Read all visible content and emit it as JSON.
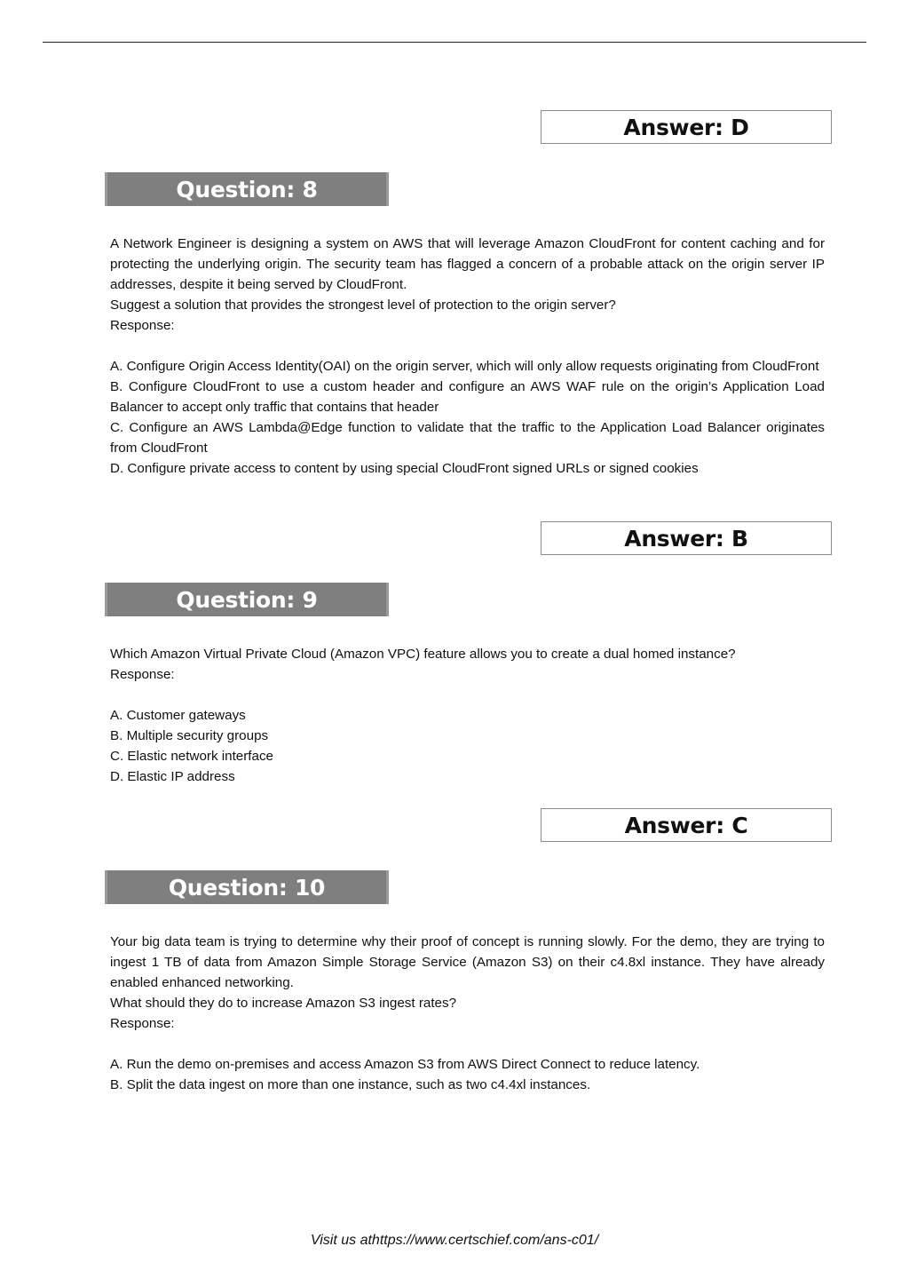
{
  "page": {
    "answers": [
      {
        "label": "Answer: D"
      },
      {
        "label": "Answer: B"
      },
      {
        "label": "Answer: C"
      }
    ],
    "questions": [
      {
        "title": "Question: 8",
        "stem": "A Network Engineer is designing a system on AWS that will leverage Amazon CloudFront for content caching and for protecting the underlying origin. The security team has flagged a concern of a probable attack on the origin server IP addresses, despite it being served by CloudFront.",
        "prompt": "Suggest a solution that provides the strongest level of protection to the origin server?",
        "response_label": "Response:",
        "options": [
          "A. Configure Origin Access Identity(OAI) on the origin server, which will only allow requests originating from CloudFront",
          "B. Configure CloudFront to use a custom header and configure an AWS WAF rule on the origin’s Application Load Balancer to accept only traffic that contains that header",
          "C. Configure an AWS Lambda@Edge function to validate that the traffic to the Application Load Balancer originates from CloudFront",
          "D. Configure private access to content by using special CloudFront signed URLs or signed cookies"
        ]
      },
      {
        "title": "Question: 9",
        "stem": "Which Amazon Virtual Private Cloud (Amazon VPC) feature allows you to create a dual homed instance?",
        "response_label": "Response:",
        "options": [
          "A. Customer gateways",
          "B. Multiple security groups",
          "C. Elastic network interface",
          "D. Elastic IP address"
        ]
      },
      {
        "title": "Question: 10",
        "stem": "Your big data team is trying to determine why their proof of concept is running slowly. For the demo, they are trying to ingest 1 TB of data from Amazon Simple Storage Service (Amazon S3) on their c4.8xl instance. They have already enabled enhanced networking.",
        "prompt": "What should they do to increase Amazon S3 ingest rates?",
        "response_label": "Response:",
        "options": [
          "A. Run the demo on-premises and access Amazon S3 from AWS Direct Connect to reduce latency.",
          "B. Split the data ingest on more than one instance, such as two c4.4xl instances."
        ]
      }
    ],
    "footer": "Visit us athttps://www.certschief.com/ans-c01/"
  }
}
